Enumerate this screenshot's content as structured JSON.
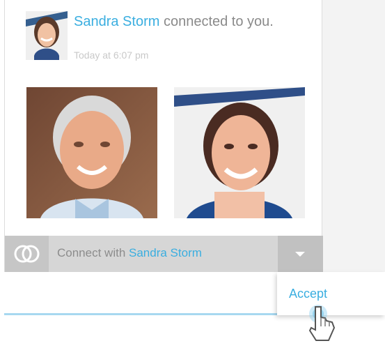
{
  "notification": {
    "user_name": "Sandra Storm",
    "action_text": "connected to you.",
    "timestamp": "Today at 6:07 pm"
  },
  "connect_bar": {
    "prefix": "Connect with",
    "user_name": "Sandra Storm",
    "icon": "connect-rings-icon",
    "dropdown_icon": "caret-down-icon"
  },
  "dropdown_menu": {
    "items": [
      {
        "label": "Accept"
      }
    ]
  },
  "pointer": {
    "icon": "hand-pointer-cursor-icon"
  },
  "colors": {
    "accent": "#3aaee0",
    "muted_text": "#8a8a8a",
    "bar_background": "#d6d6d6",
    "dropdown_button": "#c1c1c1"
  }
}
